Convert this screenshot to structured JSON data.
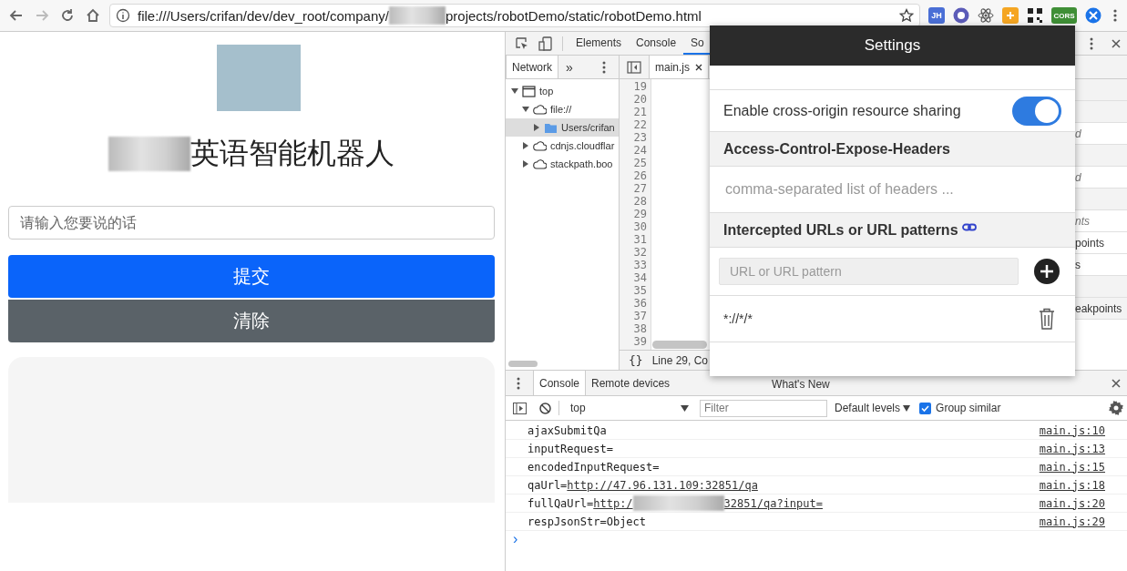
{
  "browser": {
    "url_start": "file:///Users/crifan/dev/dev_root/company/",
    "url_end": "projects/robotDemo/static/robotDemo.html",
    "extensions": [
      {
        "kind": "jh",
        "label": "JH"
      },
      {
        "kind": "w"
      },
      {
        "kind": "react"
      },
      {
        "kind": "orange"
      },
      {
        "kind": "qr"
      },
      {
        "kind": "cors",
        "label": "CORS"
      },
      {
        "kind": "blue"
      }
    ]
  },
  "page": {
    "title": "英语智能机器人",
    "input": {
      "placeholder": "请输入您要说的话"
    },
    "buttons": [
      {
        "label": "提交",
        "kind": "primary"
      },
      {
        "label": "清除",
        "kind": "secondary"
      }
    ]
  },
  "devtools": {
    "tabs": [
      {
        "label": "Elements",
        "selected": false
      },
      {
        "label": "Console",
        "selected": false
      },
      {
        "label": "So",
        "selected": true
      }
    ],
    "navigator": {
      "tabs": [
        {
          "label": "Network",
          "selected": true
        }
      ],
      "more": "»",
      "tree": [
        {
          "label": "top",
          "kind": "frame",
          "expanded": true,
          "selected": false,
          "children": [
            {
              "label": "file://",
              "kind": "cloud",
              "expanded": true,
              "selected": false,
              "children": [
                {
                  "label": "Users/crifan",
                  "kind": "folder",
                  "expanded": false,
                  "selected": true
                }
              ]
            },
            {
              "label": "cdnjs.cloudflar",
              "kind": "cloud",
              "expanded": false,
              "selected": false
            },
            {
              "label": "stackpath.boo",
              "kind": "cloud",
              "expanded": false,
              "selected": false
            }
          ]
        }
      ]
    },
    "editor": {
      "tabs": [
        {
          "label": "main.js",
          "selected": true
        }
      ],
      "lines": [
        {
          "number": "19"
        },
        {
          "number": "20"
        },
        {
          "number": "21"
        },
        {
          "number": "22"
        },
        {
          "number": "23"
        },
        {
          "number": "24"
        },
        {
          "number": "25"
        },
        {
          "number": "26"
        },
        {
          "number": "27"
        },
        {
          "number": "28"
        },
        {
          "number": "29"
        },
        {
          "number": "30"
        },
        {
          "number": "31"
        },
        {
          "number": "32"
        },
        {
          "number": "33"
        },
        {
          "number": "34"
        },
        {
          "number": "35"
        },
        {
          "number": "36"
        },
        {
          "number": "37"
        },
        {
          "number": "38"
        },
        {
          "number": "39"
        }
      ],
      "format_button": "{}",
      "status": "Line 29, Co"
    },
    "sidebar_rows": [
      {
        "kind": "header"
      },
      {
        "kind": "header"
      },
      {
        "kind": "placeholder",
        "text": "d"
      },
      {
        "kind": "header"
      },
      {
        "kind": "placeholder",
        "text": "d"
      },
      {
        "kind": "header"
      },
      {
        "kind": "placeholder",
        "text": "nts"
      },
      {
        "kind": "item",
        "text": "points"
      },
      {
        "kind": "item",
        "text": "s"
      },
      {
        "kind": "header"
      },
      {
        "kind": "header",
        "text": "eakpoints"
      }
    ],
    "drawer": {
      "tabs": [
        {
          "label": "Console",
          "selected": true
        },
        {
          "label": "Remote devices",
          "selected": false
        },
        {
          "label": "What's New",
          "selected": false
        }
      ],
      "context": "top",
      "filter_placeholder": "Filter",
      "levels": "Default levels",
      "group_similar": {
        "label": "Group similar",
        "checked": true
      },
      "messages": [
        {
          "text": "ajaxSubmitQa",
          "source": "main.js:10"
        },
        {
          "text": "inputRequest=",
          "source": "main.js:13"
        },
        {
          "text": "encodedInputRequest=",
          "source": "main.js:15"
        },
        {
          "text": "qaUrl=",
          "links": [
            "http://47.96.131.109:32851/qa"
          ],
          "source": "main.js:18"
        },
        {
          "text": "fullQaUrl=",
          "links": [
            "http:/",
            "32851/qa?input="
          ],
          "source": "main.js:20"
        },
        {
          "text": "respJsonStr=Object",
          "source": "main.js:29"
        }
      ],
      "prompt": "›"
    }
  },
  "cors": {
    "title": "Settings",
    "enable": {
      "label": "Enable cross-origin resource sharing",
      "on": true
    },
    "expose_headers": {
      "heading": "Access-Control-Expose-Headers",
      "placeholder": "comma-separated list of headers ..."
    },
    "intercepted": {
      "heading": "Intercepted URLs or URL patterns",
      "placeholder": "URL or URL pattern",
      "patterns": [
        "*://*/*"
      ]
    }
  }
}
